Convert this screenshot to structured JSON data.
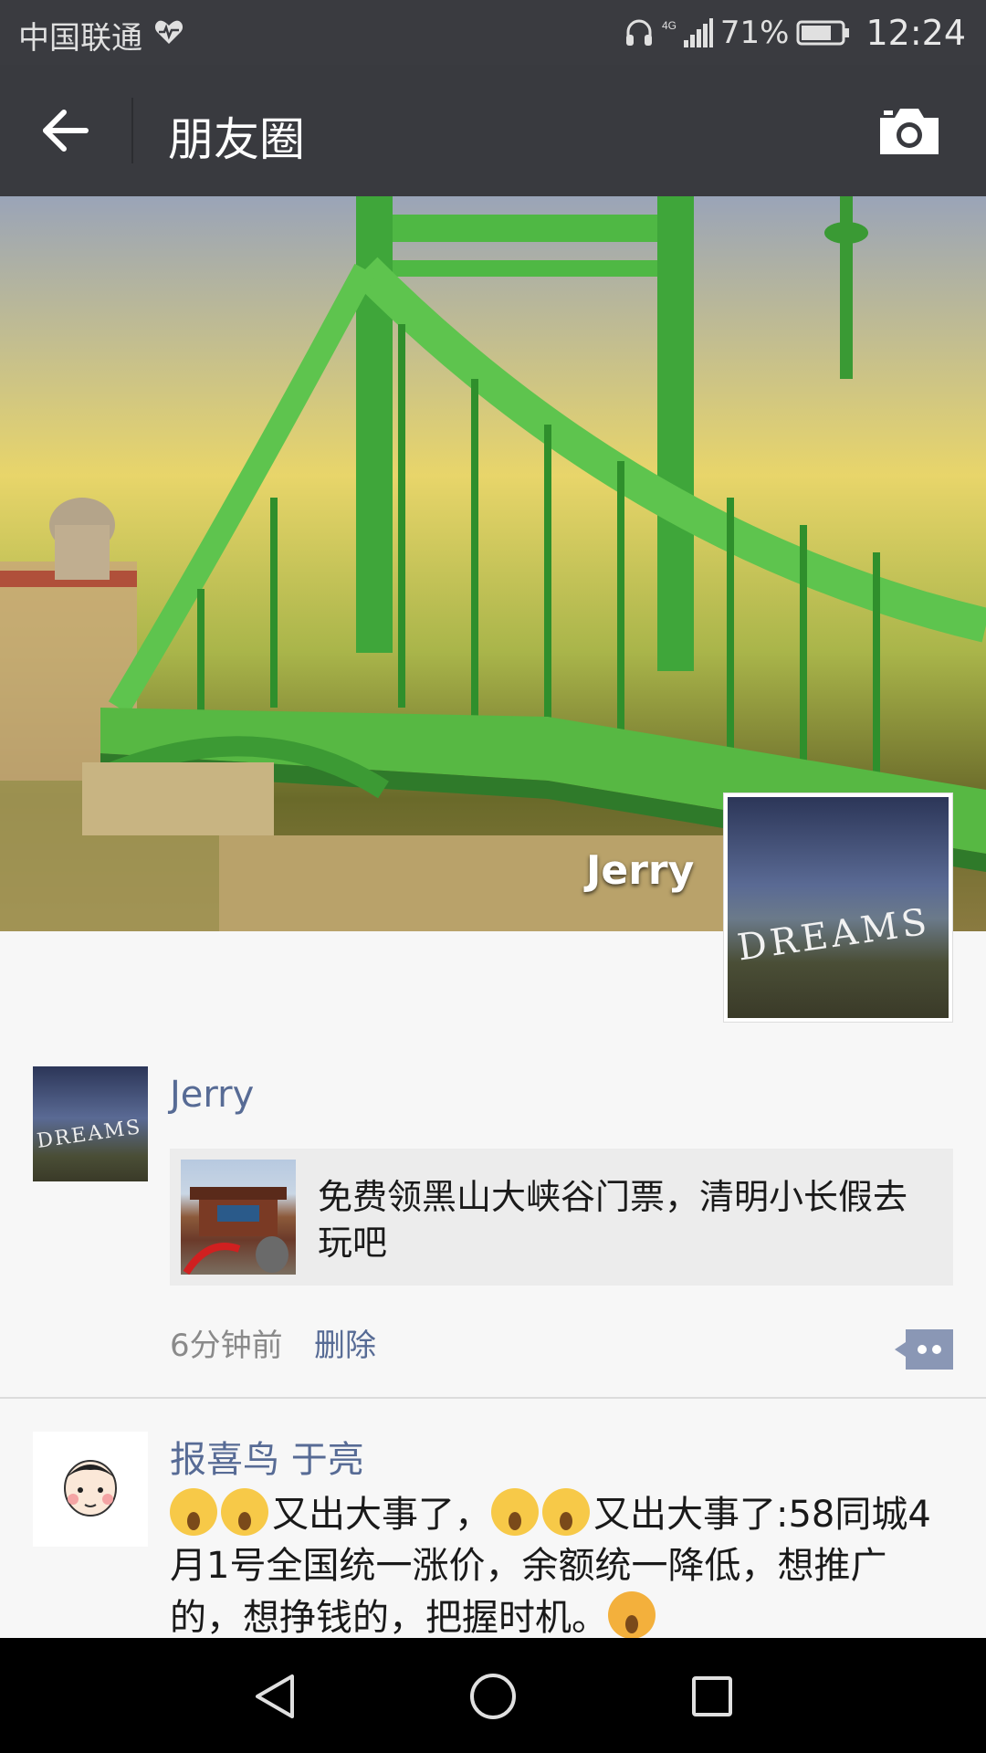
{
  "status_bar": {
    "carrier": "中国联通",
    "signal_label": "4G",
    "battery": "71%",
    "time": "12:24"
  },
  "header": {
    "title": "朋友圈"
  },
  "cover": {
    "user_name": "Jerry",
    "avatar_text": "DREAMS"
  },
  "posts": [
    {
      "author": "Jerry",
      "avatar_text": "DREAMS",
      "share": {
        "text": "免费领黑山大峡谷门票，清明小长假去玩吧"
      },
      "time": "6分钟前",
      "delete_label": "删除"
    },
    {
      "author": "报喜鸟 于亮",
      "text_part1": "又出大事了，",
      "text_part2": "又出大事了:58同城4月1号全国统一涨价，余额统一降低，想推广的，想挣钱的，把握时机。"
    }
  ],
  "colors": {
    "link": "#576b95",
    "titlebar": "#393a3f",
    "statusbar": "#3a3b40"
  }
}
